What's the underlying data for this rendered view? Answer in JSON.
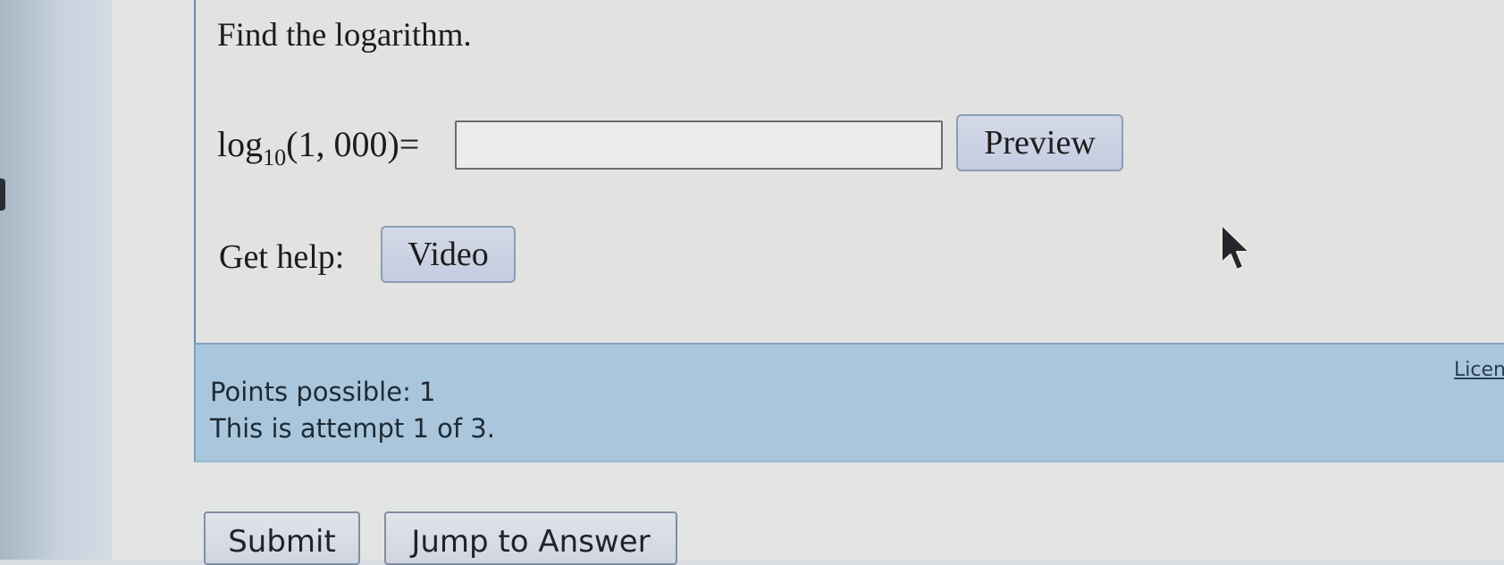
{
  "question": {
    "title": "Find the logarithm.",
    "math": {
      "func": "log",
      "base": "10",
      "argument": "(1, 000)",
      "equals": "="
    },
    "answer_value": "",
    "preview_label": "Preview",
    "help_label": "Get help:",
    "video_label": "Video"
  },
  "info": {
    "points_possible": "Points possible: 1",
    "attempt": "This is attempt 1 of 3.",
    "license_link": "Licen"
  },
  "actions": {
    "submit_label": "Submit",
    "jump_label": "Jump to Answer"
  },
  "icons": {
    "cursor": "mouse-pointer-arrow-icon"
  },
  "colors": {
    "info_bar": "#a9c6dc",
    "button_fill": "#c4cce0",
    "question_border": "#5f87ad"
  }
}
